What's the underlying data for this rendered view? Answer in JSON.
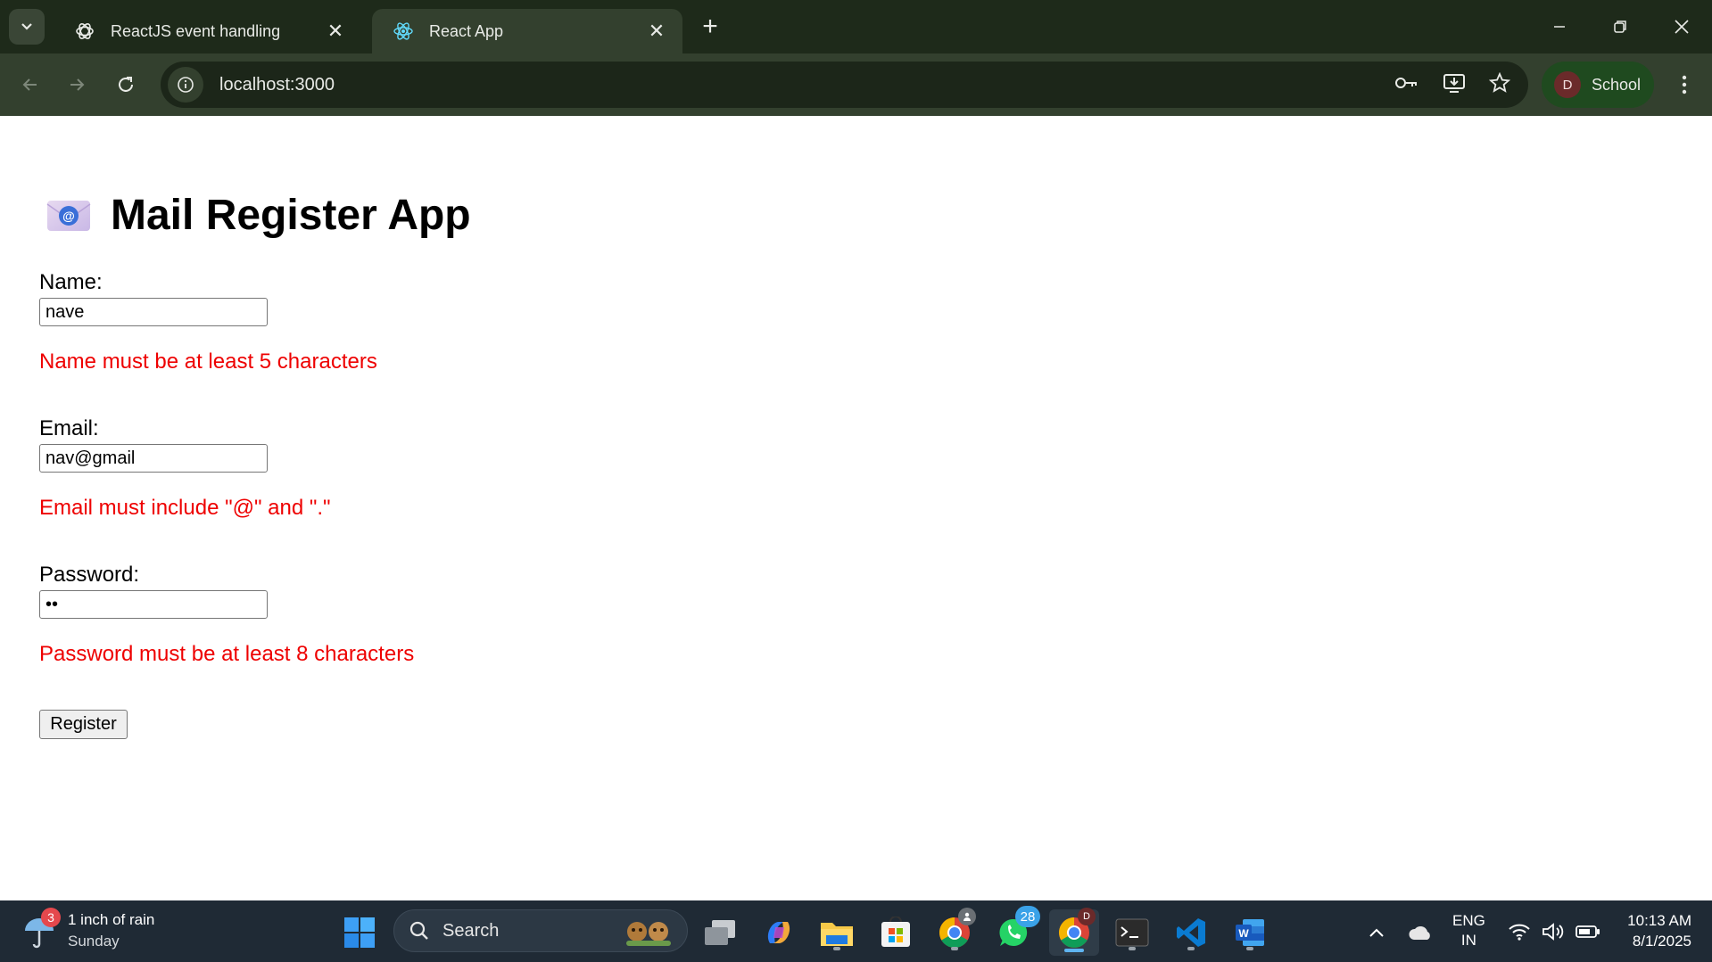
{
  "browser": {
    "tabs": [
      {
        "title": "ReactJS event handling",
        "icon": "openai-icon",
        "active": false
      },
      {
        "title": "React App",
        "icon": "react-icon",
        "active": true
      }
    ],
    "url": "localhost:3000",
    "profile": {
      "initial": "D",
      "name": "School"
    }
  },
  "app": {
    "title": "Mail Register App",
    "title_icon": "email-emoji-icon",
    "fields": {
      "name": {
        "label": "Name:",
        "value": "nave",
        "error": "Name must be at least 5 characters"
      },
      "email": {
        "label": "Email:",
        "value": "nav@gmail",
        "error": "Email must include \"@\" and \".\""
      },
      "password": {
        "label": "Password:",
        "value": "••",
        "error": "Password must be at least 8 characters"
      }
    },
    "submit_label": "Register",
    "error_color": "#ee0000"
  },
  "taskbar": {
    "weather": {
      "badge": "3",
      "line1": "1 inch of rain",
      "line2": "Sunday"
    },
    "search_label": "Search",
    "whatsapp_badge": "28",
    "chrome_badge": "D",
    "language": {
      "line1": "ENG",
      "line2": "IN"
    },
    "clock": {
      "time": "10:13 AM",
      "date": "8/1/2025"
    }
  }
}
